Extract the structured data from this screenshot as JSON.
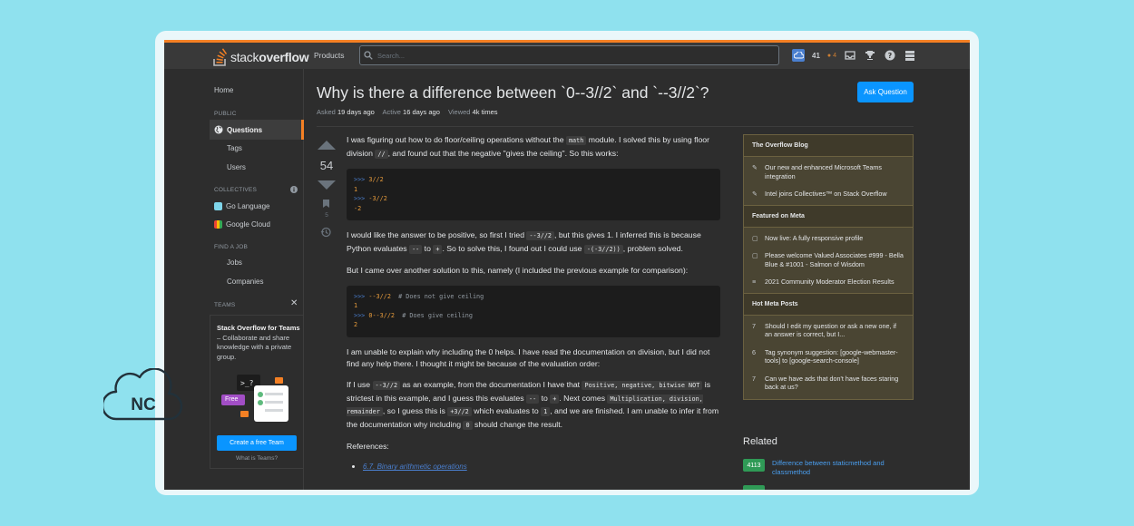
{
  "topbar": {
    "logo_plain": "stack",
    "logo_bold": "overflow",
    "products": "Products",
    "search_placeholder": "Search...",
    "reputation": "41",
    "bronze_badges": "4",
    "accent": "#f48024"
  },
  "leftnav": {
    "home": "Home",
    "public": "PUBLIC",
    "questions": "Questions",
    "tags": "Tags",
    "users": "Users",
    "collectives_header": "COLLECTIVES",
    "collectives": [
      "Go Language",
      "Google Cloud"
    ],
    "find_job": "FIND A JOB",
    "jobs": "Jobs",
    "companies": "Companies",
    "teams_header": "TEAMS",
    "teams_title_bold": "Stack Overflow for Teams",
    "teams_title_rest": " – Collaborate and share knowledge with a private group.",
    "free_badge": "Free",
    "create_team": "Create a free Team",
    "what_is_teams": "What is Teams?"
  },
  "question": {
    "title": "Why is there a difference between `0--3//2` and `--3//2`?",
    "ask_button": "Ask Question",
    "asked_label": "Asked",
    "asked_value": "19 days ago",
    "active_label": "Active",
    "active_value": "16 days ago",
    "viewed_label": "Viewed",
    "viewed_value": "4k times",
    "score": "54",
    "bookmarks": "5",
    "p1_a": "I was figuring out how to do floor/ceiling operations without the ",
    "p1_code1": "math",
    "p1_b": " module. I solved this by using floor division ",
    "p1_code2": "//",
    "p1_c": ", and found out that the negative \"gives the ceiling\". So this works:",
    "code1": [
      {
        "prompt": ">>> ",
        "expr": "3//2",
        "comment": ""
      },
      {
        "prompt": "",
        "expr": "1",
        "comment": ""
      },
      {
        "prompt": ">>> ",
        "expr": "-3//2",
        "comment": ""
      },
      {
        "prompt": "",
        "expr": "-2",
        "comment": ""
      }
    ],
    "p2_a": "I would like the answer to be positive, so first I tried ",
    "p2_code1": "--3//2",
    "p2_b": ", but this gives 1. I inferred this is because Python evaluates ",
    "p2_code2": "--",
    "p2_c": " to ",
    "p2_code3": "+",
    "p2_d": ". So to solve this, I found out I could use ",
    "p2_code4": "-(-3//2))",
    "p2_e": ", problem solved.",
    "p3": "But I came over another solution to this, namely (I included the previous example for comparison):",
    "code2": [
      {
        "prompt": ">>> ",
        "expr": "--3//2",
        "comment": "  # Does not give ceiling"
      },
      {
        "prompt": "",
        "expr": "1",
        "comment": ""
      },
      {
        "prompt": ">>> ",
        "expr": "0--3//2",
        "comment": "  # Does give ceiling"
      },
      {
        "prompt": "",
        "expr": "2",
        "comment": ""
      }
    ],
    "p4": "I am unable to explain why including the 0 helps. I have read the documentation on division, but I did not find any help there. I thought it might be because of the evaluation order:",
    "p5_a": "If I use ",
    "p5_code1": "--3//2",
    "p5_b": " as an example, from the documentation I have that ",
    "p5_code2": "Positive, negative, bitwise NOT",
    "p5_c": " is strictest in this example, and I guess this evaluates ",
    "p5_code3": "--",
    "p5_d": " to ",
    "p5_code4": "+",
    "p5_e": ". Next comes ",
    "p5_code5": "Multiplication, division, remainder",
    "p5_f": ", so I guess this is ",
    "p5_code6": "+3//2",
    "p5_g": " which evaluates to ",
    "p5_code7": "1",
    "p5_h": ", and we are finished. I am unable to infer it from the documentation why including ",
    "p5_code8": "0",
    "p5_i": " should change the result.",
    "references": "References:",
    "ref1": "6.7. Binary arithmetic operations"
  },
  "sidebar": {
    "blog_header": "The Overflow Blog",
    "blog": [
      "Our new and enhanced Microsoft Teams integration",
      "Intel joins Collectives™ on Stack Overflow"
    ],
    "meta_header": "Featured on Meta",
    "meta": [
      "Now live: A fully responsive profile",
      "Please welcome Valued Associates #999 - Bella Blue & #1001 - Salmon of Wisdom",
      "2021 Community Moderator Election Results"
    ],
    "hot_header": "Hot Meta Posts",
    "hot": [
      {
        "count": "7",
        "text": "Should I edit my question or ask a new one, if an answer is correct, but I..."
      },
      {
        "count": "6",
        "text": "Tag synonym suggestion: [google-webmaster-tools] to [google-search-console]"
      },
      {
        "count": "7",
        "text": "Can we have ads that don't have faces staring back at us?"
      }
    ],
    "related_header": "Related",
    "related": [
      {
        "score": "4113",
        "text": "Difference between staticmethod and classmethod"
      }
    ]
  },
  "overlay": {
    "nc_label": "NC"
  }
}
